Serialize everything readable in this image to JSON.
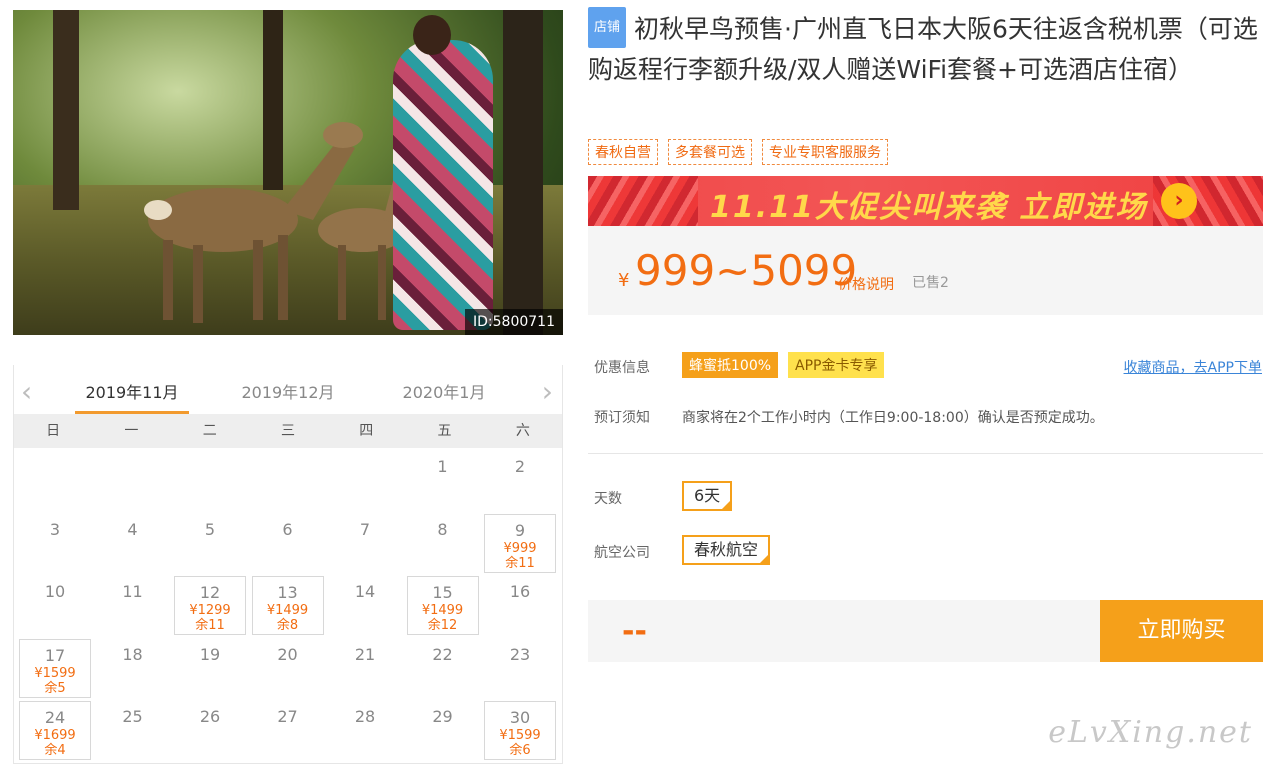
{
  "photo": {
    "id_badge": "ID:5800711"
  },
  "calendar": {
    "months": [
      "2019年11月",
      "2019年12月",
      "2020年1月"
    ],
    "active_month_index": 0,
    "weekdays": [
      "日",
      "一",
      "二",
      "三",
      "四",
      "五",
      "六"
    ],
    "prev_icon": "chevron-left-icon",
    "next_icon": "chevron-right-icon",
    "days": [
      {
        "day": "1",
        "col": 5,
        "row": 0
      },
      {
        "day": "2",
        "col": 6,
        "row": 0
      },
      {
        "day": "3",
        "col": 0,
        "row": 1
      },
      {
        "day": "4",
        "col": 1,
        "row": 1
      },
      {
        "day": "5",
        "col": 2,
        "row": 1
      },
      {
        "day": "6",
        "col": 3,
        "row": 1
      },
      {
        "day": "7",
        "col": 4,
        "row": 1
      },
      {
        "day": "8",
        "col": 5,
        "row": 1
      },
      {
        "day": "9",
        "col": 6,
        "row": 1,
        "price": "¥999",
        "stock": "余11"
      },
      {
        "day": "10",
        "col": 0,
        "row": 2
      },
      {
        "day": "11",
        "col": 1,
        "row": 2
      },
      {
        "day": "12",
        "col": 2,
        "row": 2,
        "price": "¥1299",
        "stock": "余11"
      },
      {
        "day": "13",
        "col": 3,
        "row": 2,
        "price": "¥1499",
        "stock": "余8"
      },
      {
        "day": "14",
        "col": 4,
        "row": 2
      },
      {
        "day": "15",
        "col": 5,
        "row": 2,
        "price": "¥1499",
        "stock": "余12"
      },
      {
        "day": "16",
        "col": 6,
        "row": 2
      },
      {
        "day": "17",
        "col": 0,
        "row": 3,
        "price": "¥1599",
        "stock": "余5"
      },
      {
        "day": "18",
        "col": 1,
        "row": 3
      },
      {
        "day": "19",
        "col": 2,
        "row": 3
      },
      {
        "day": "20",
        "col": 3,
        "row": 3
      },
      {
        "day": "21",
        "col": 4,
        "row": 3
      },
      {
        "day": "22",
        "col": 5,
        "row": 3
      },
      {
        "day": "23",
        "col": 6,
        "row": 3
      },
      {
        "day": "24",
        "col": 0,
        "row": 4,
        "price": "¥1699",
        "stock": "余4"
      },
      {
        "day": "25",
        "col": 1,
        "row": 4
      },
      {
        "day": "26",
        "col": 2,
        "row": 4
      },
      {
        "day": "27",
        "col": 3,
        "row": 4
      },
      {
        "day": "28",
        "col": 4,
        "row": 4
      },
      {
        "day": "29",
        "col": 5,
        "row": 4
      },
      {
        "day": "30",
        "col": 6,
        "row": 4,
        "price": "¥1599",
        "stock": "余6"
      }
    ]
  },
  "product": {
    "shop_tag": "店铺",
    "title": "初秋早鸟预售·广州直飞日本大阪6天往返含税机票（可选购返程行李额升级/双人赠送WiFi套餐+可选酒店住宿）",
    "tags": [
      "春秋自营",
      "多套餐可选",
      "专业专职客服服务"
    ],
    "banner_text": "11.11大促尖叫来袭 立即进场",
    "banner_icon": "arrow-right-circle-icon",
    "currency": "¥",
    "price_range": "999~5099",
    "price_explain": "价格说明",
    "sold": "已售2"
  },
  "info": {
    "discount_label": "优惠信息",
    "discount_badge1": "蜂蜜抵100%",
    "discount_badge2": "APP金卡专享",
    "fav_link": "收藏商品，去APP下单",
    "notice_label": "预订须知",
    "notice_text": "商家将在2个工作小时内（工作日9:00-18:00）确认是否预定成功。"
  },
  "options": {
    "days_label": "天数",
    "days_value": "6天",
    "airline_label": "航空公司",
    "airline_value": "春秋航空"
  },
  "buy": {
    "total_placeholder": "--",
    "button_label": "立即购买"
  },
  "watermark": "eLvXing.net",
  "colors": {
    "accent": "#f5a01a",
    "price": "#f26d12",
    "link": "#3b85d8"
  }
}
